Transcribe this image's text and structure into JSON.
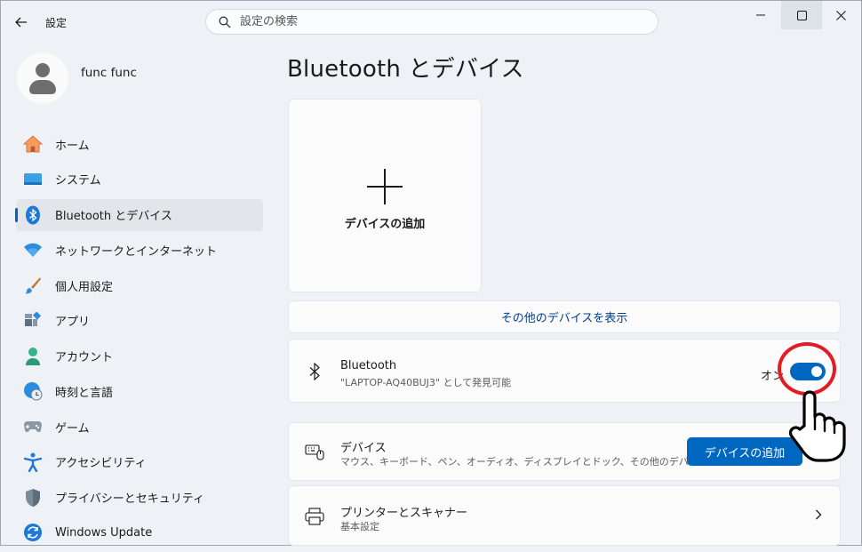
{
  "window": {
    "title": "設定",
    "controls": [
      "minimize-icon",
      "maximize-icon",
      "close-icon"
    ]
  },
  "search": {
    "placeholder": "設定の検索",
    "icon": "search-icon"
  },
  "profile": {
    "name": "func func"
  },
  "sidebar": {
    "items": [
      {
        "label": "ホーム",
        "icon": "home-icon",
        "active": false
      },
      {
        "label": "システム",
        "icon": "monitor-icon",
        "active": false
      },
      {
        "label": "Bluetooth とデバイス",
        "icon": "bluetooth-icon",
        "active": true
      },
      {
        "label": "ネットワークとインターネット",
        "icon": "wifi-icon",
        "active": false
      },
      {
        "label": "個人用設定",
        "icon": "paintbrush-icon",
        "active": false
      },
      {
        "label": "アプリ",
        "icon": "apps-icon",
        "active": false
      },
      {
        "label": "アカウント",
        "icon": "person-icon",
        "active": false
      },
      {
        "label": "時刻と言語",
        "icon": "globe-clock-icon",
        "active": false
      },
      {
        "label": "ゲーム",
        "icon": "gamepad-icon",
        "active": false
      },
      {
        "label": "アクセシビリティ",
        "icon": "accessibility-icon",
        "active": false
      },
      {
        "label": "プライバシーとセキュリティ",
        "icon": "shield-icon",
        "active": false
      },
      {
        "label": "Windows Update",
        "icon": "update-icon",
        "active": false
      }
    ]
  },
  "main": {
    "title": "Bluetooth とデバイス",
    "add_tile": {
      "label": "デバイスの追加",
      "icon": "plus-icon"
    },
    "more_devices": "その他のデバイスを表示",
    "bluetooth": {
      "title": "Bluetooth",
      "subtitle": "\"LAPTOP-AQ40BUJ3\" として発見可能",
      "toggle_label": "オン",
      "toggle_on": true
    },
    "devices": {
      "title": "デバイス",
      "subtitle": "マウス、キーボード、ペン、オーディオ、ディスプレイとドック、その他のデバイス",
      "button": "デバイスの追加"
    },
    "printers": {
      "title": "プリンターとスキャナー",
      "subtitle": "基本設定"
    }
  },
  "colors": {
    "accent": "#0067c0",
    "highlight": "#e31b23",
    "background": "#eef2f6"
  }
}
